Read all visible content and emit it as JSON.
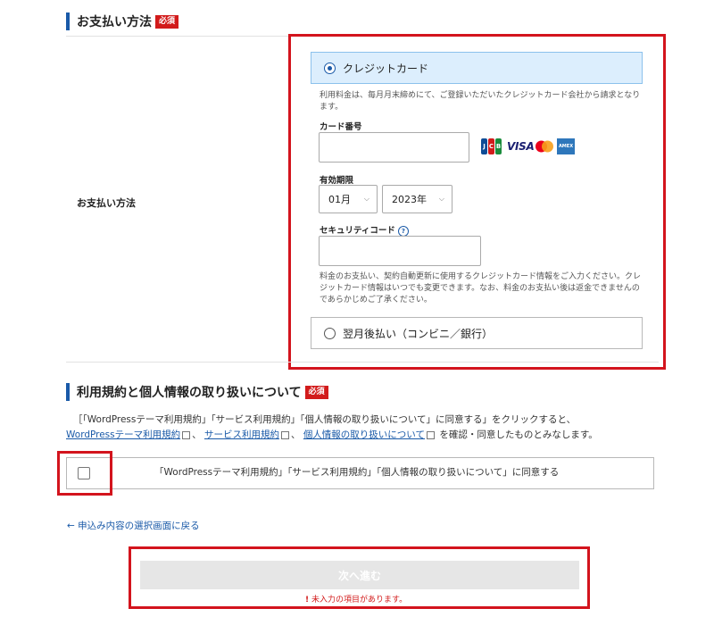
{
  "payment_section": {
    "title": "お支払い方法",
    "required_badge": "必須",
    "row_label": "お支払い方法"
  },
  "payment_options": {
    "credit": {
      "label": "クレジットカード",
      "selected": true,
      "note": "利用料金は、毎月月末締めにて、ご登録いただいたクレジットカード会社から請求となります。",
      "card_number_label": "カード番号",
      "card_number_value": "",
      "expiry_label": "有効期限",
      "expiry_month": "01月",
      "expiry_year": "2023年",
      "security_label": "セキュリティコード",
      "security_help": "?",
      "security_value": "",
      "info_note": "料金のお支払い、契約自動更新に使用するクレジットカード情報をご入力ください。クレジットカード情報はいつでも変更できます。なお、料金のお支払い後は返金できませんのであらかじめご了承ください。",
      "brands": {
        "visa": "VISA",
        "amex": "AMEX"
      }
    },
    "deferred": {
      "label": "翌月後払い（コンビニ／銀行）",
      "selected": false
    }
  },
  "terms_section": {
    "title": "利用規約と個人情報の取り扱いについて",
    "required_badge": "必須",
    "desc_prefix": "［「WordPressテーマ利用規約」「サービス利用規約」「個人情報の取り扱いについて」に同意する」をクリックすると、",
    "link1": "WordPressテーマ利用規約",
    "sep": "、",
    "link2": "サービス利用規約",
    "link3": "個人情報の取り扱いについて",
    "desc_suffix": "を確認・同意したものとみなします。",
    "agree_label": "「WordPressテーマ利用規約」「サービス利用規約」「個人情報の取り扱いについて」に同意する",
    "agree_checked": false
  },
  "back_link": "← 申込み内容の選択画面に戻る",
  "next_button": "次へ進む",
  "warning": "未入力の項目があります。",
  "warning_icon": "!",
  "colors": {
    "accent": "#1a5aa8",
    "required": "#d21b1b",
    "highlight_border": "#d3141d",
    "selected_bg": "#dceefd"
  }
}
